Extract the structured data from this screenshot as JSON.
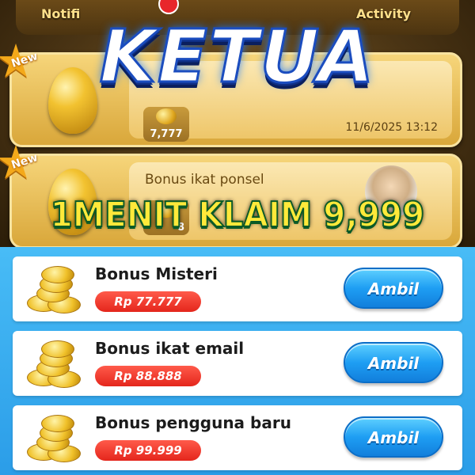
{
  "tabs": {
    "left": "Notifi",
    "right": "Activity"
  },
  "headline": {
    "main": "KETUA",
    "sub": "1MENIT KLAIM 9,999"
  },
  "notifications": [
    {
      "badge": "New",
      "title": "",
      "reward": "7,777",
      "time": "11/6/2025 13:12"
    },
    {
      "badge": "New",
      "title": "Bonus ikat ponsel",
      "reward": "8"
    }
  ],
  "bonuses": [
    {
      "title": "Bonus Misteri",
      "amount": "Rp 77.777",
      "button": "Ambil"
    },
    {
      "title": "Bonus ikat email",
      "amount": "Rp 88.888",
      "button": "Ambil"
    },
    {
      "title": "Bonus pengguna baru",
      "amount": "Rp 99.999",
      "button": "Ambil"
    }
  ],
  "colors": {
    "gold_panel": "#d9a73a",
    "blue_panel": "#2b9de8",
    "button_blue": "#1e9ef3",
    "amount_red": "#e4261c",
    "headline_yellow": "#ffe93a"
  }
}
